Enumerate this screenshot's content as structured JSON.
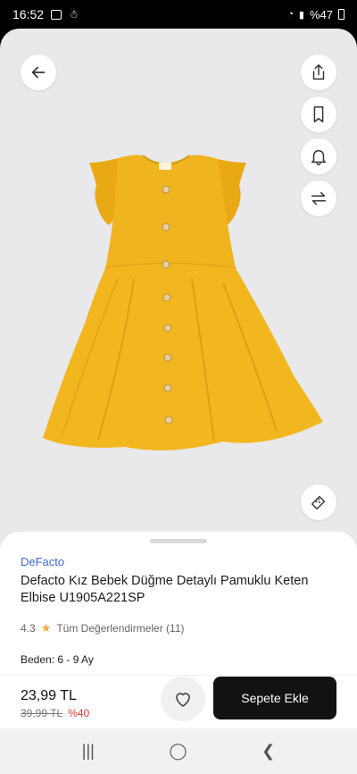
{
  "status": {
    "time": "16:52",
    "battery": "%47"
  },
  "product": {
    "brand": "DeFacto",
    "title": "Defacto Kız Bebek Düğme Detaylı Pamuklu Keten Elbise U1905A221SP",
    "rating": "4.3",
    "reviews_label": "Tüm Değerlendirmeler (11)",
    "size_label": "Beden: 6 - 9 Ay",
    "price": "23,99 TL",
    "old_price": "39,99 TL",
    "discount": "%40",
    "add_to_cart": "Sepete Ekle"
  },
  "colors": {
    "accent": "#3d6bd8",
    "dress": "#f0b41f",
    "discount": "#e23a3a",
    "cart_button": "#121212"
  },
  "icons": [
    "back-arrow-icon",
    "share-icon",
    "bookmark-icon",
    "bell-icon",
    "compare-arrows-icon",
    "size-ruler-icon",
    "heart-icon"
  ]
}
